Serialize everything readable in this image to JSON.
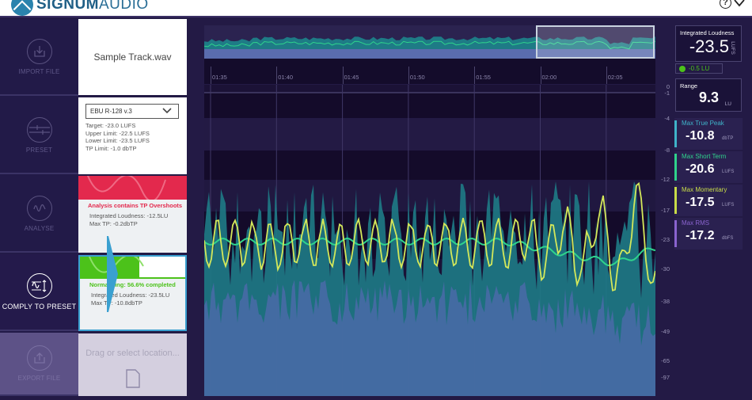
{
  "app": {
    "brand_bold": "SIGNUM",
    "brand_light": "AUDIO",
    "help_icon": "help-circle-icon",
    "menu_icon": "chevron-down-icon"
  },
  "nav": {
    "items": [
      {
        "label": "IMPORT FILE",
        "icon": "import-icon",
        "state": "idle"
      },
      {
        "label": "PRESET",
        "icon": "sliders-icon",
        "state": "idle"
      },
      {
        "label": "ANALYSE",
        "icon": "waveform-icon",
        "state": "idle"
      },
      {
        "label": "COMPLY TO PRESET",
        "icon": "comply-icon",
        "state": "active"
      },
      {
        "label": "EXPORT FILE",
        "icon": "export-icon",
        "state": "disabled"
      }
    ]
  },
  "cards": {
    "file": {
      "name": "Sample Track.wav"
    },
    "preset": {
      "selected": "EBU R-128 v.3",
      "lines": [
        "Target: -23.0 LUFS",
        "Upper Limit: -22.5 LUFS",
        "Lower Limit: -23.5 LUFS",
        "TP Limit: -1.0 dbTP"
      ]
    },
    "analyse": {
      "status": "Analysis contains TP Overshoots",
      "lines": [
        "Integrated Loudness: -12.5LU",
        "Max TP: -0.2dbTP"
      ],
      "status_color": "#e3294d"
    },
    "comply": {
      "status": "Normalising: 56.6% completed",
      "progress": 0.566,
      "lines": [
        "Integrated Loudness: -23.5LU",
        "Max TP: -10.8dbTP"
      ],
      "status_color": "#4cc21a"
    },
    "export": {
      "hint": "Drag or select location..."
    }
  },
  "graph": {
    "time_ticks": [
      "01:35",
      "01:40",
      "01:45",
      "01:50",
      "01:55",
      "02:00",
      "02:05"
    ],
    "y_ticks": [
      "0",
      "-1",
      "-4",
      "-8",
      "-12",
      "-17",
      "-23",
      "-30",
      "-38",
      "-49",
      "-65",
      "-97"
    ],
    "colors": {
      "momentary": "#d4e85a",
      "short_term": "#2fd38c",
      "peak_fill": "#1e7b86",
      "rms_fill": "#4a6aa8"
    }
  },
  "meters": {
    "integrated": {
      "title": "Integrated Loudness",
      "value": "-23.5",
      "unit": "LUFS",
      "diff": "-0.5 LU"
    },
    "range": {
      "title": "Range",
      "value": "9.3",
      "unit": "LU"
    },
    "stats": [
      {
        "title": "Max True Peak",
        "value": "-10.8",
        "unit": "dbTP",
        "color": "#3fb3c9"
      },
      {
        "title": "Max Short Term",
        "value": "-20.6",
        "unit": "LUFS",
        "color": "#2fd38c"
      },
      {
        "title": "Max Momentary",
        "value": "-17.5",
        "unit": "LUFS",
        "color": "#c8dc48"
      },
      {
        "title": "Max RMS",
        "value": "-17.2",
        "unit": "dbFS",
        "color": "#8a63cf"
      }
    ]
  }
}
